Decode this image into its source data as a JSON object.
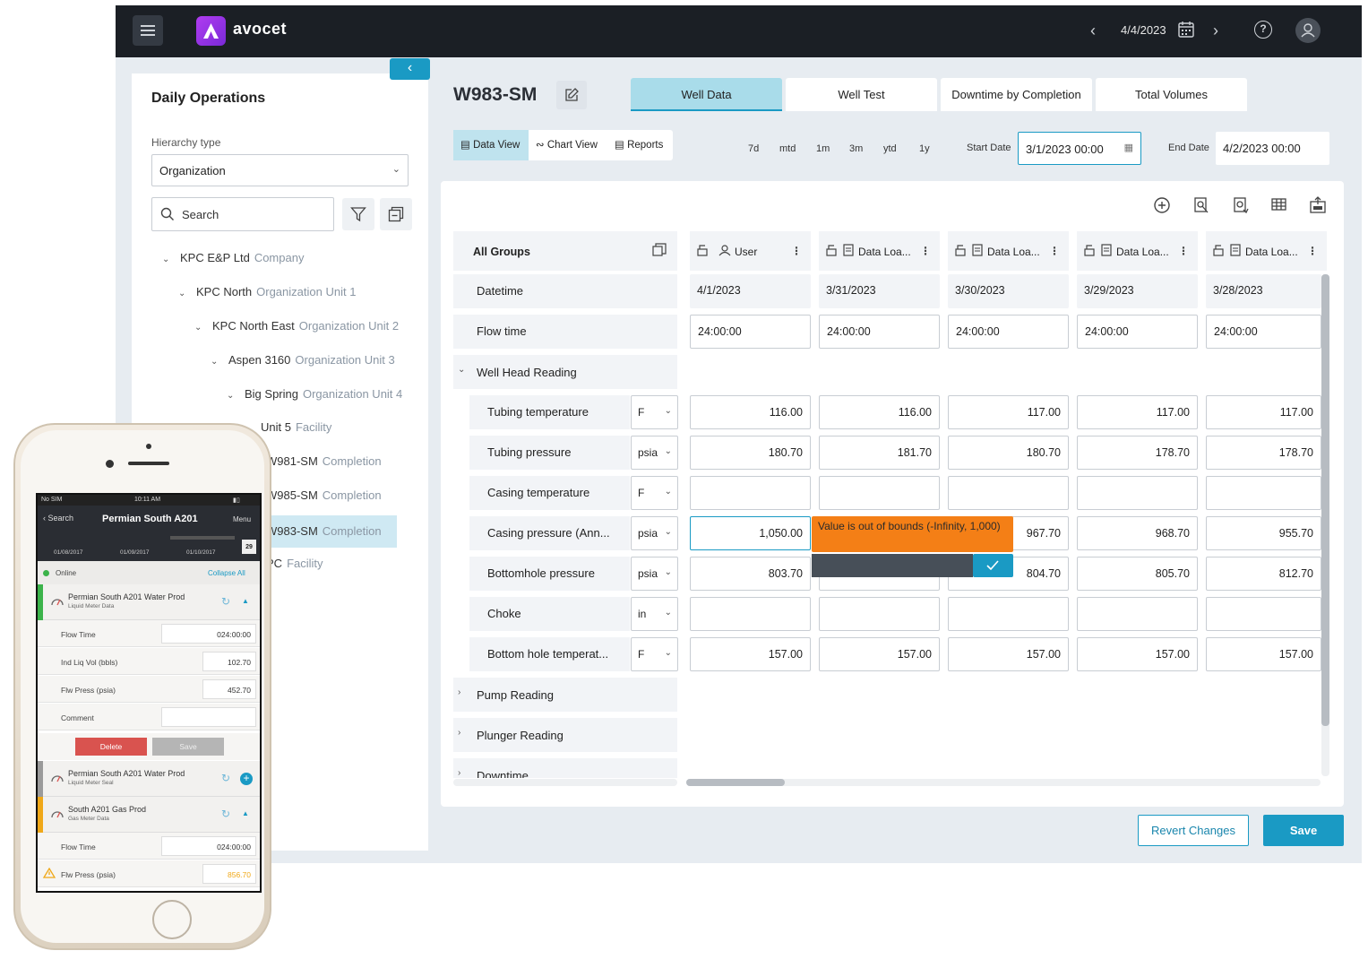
{
  "app": {
    "brand": "avocet",
    "current_date": "4/4/2023"
  },
  "left_panel": {
    "title": "Daily Operations",
    "hierarchy_label": "Hierarchy type",
    "hierarchy_value": "Organization",
    "search_placeholder": "Search",
    "tree": [
      {
        "name": "KPC E&P Ltd",
        "kind": "Company",
        "expanded": true
      },
      {
        "name": "KPC North",
        "kind": "Organization Unit 1",
        "expanded": true
      },
      {
        "name": "KPC North East",
        "kind": "Organization Unit 2",
        "expanded": true
      },
      {
        "name": "Aspen 3160",
        "kind": "Organization Unit 3",
        "expanded": true
      },
      {
        "name": "Big Spring",
        "kind": "Organization Unit 4",
        "expanded": true
      },
      {
        "name": "Unit 5",
        "kind": "Facility",
        "expanded": true
      },
      {
        "name": "W981-SM",
        "kind": "Completion"
      },
      {
        "name": "W985-SM",
        "kind": "Completion"
      },
      {
        "name": "W983-SM",
        "kind": "Completion",
        "selected": true
      },
      {
        "name": "PC",
        "kind": "Facility"
      }
    ]
  },
  "main": {
    "well_title": "W983-SM",
    "tabs": [
      "Well Data",
      "Well Test",
      "Downtime by Completion",
      "Total Volumes"
    ],
    "active_tab": "Well Data",
    "views": [
      "Data View",
      "Chart View",
      "Reports"
    ],
    "active_view": "Data View",
    "ranges": [
      "7d",
      "mtd",
      "1m",
      "3m",
      "ytd",
      "1y"
    ],
    "start_date_label": "Start Date",
    "start_date": "3/1/2023 00:00",
    "end_date_label": "End Date",
    "end_date": "4/2/2023 00:00"
  },
  "grid": {
    "groups_header": "All Groups",
    "columns": [
      {
        "label": "User",
        "date": "4/1/2023",
        "flow_time": "24:00:00"
      },
      {
        "label": "Data Loa...",
        "date": "3/31/2023",
        "flow_time": "24:00:00"
      },
      {
        "label": "Data Loa...",
        "date": "3/30/2023",
        "flow_time": "24:00:00"
      },
      {
        "label": "Data Loa...",
        "date": "3/29/2023",
        "flow_time": "24:00:00"
      },
      {
        "label": "Data Loa...",
        "date": "3/28/2023",
        "flow_time": "24:00:00"
      }
    ],
    "datetime_label": "Datetime",
    "flow_time_label": "Flow time",
    "well_head_group": "Well Head Reading",
    "rows": [
      {
        "label": "Tubing temperature",
        "unit": "F",
        "values": [
          "116.00",
          "116.00",
          "117.00",
          "117.00",
          "117.00"
        ]
      },
      {
        "label": "Tubing pressure",
        "unit": "psia",
        "values": [
          "180.70",
          "181.70",
          "180.70",
          "178.70",
          "178.70"
        ]
      },
      {
        "label": "Casing temperature",
        "unit": "F",
        "values": [
          "",
          "",
          "",
          "",
          ""
        ]
      },
      {
        "label": "Casing pressure (Ann...",
        "unit": "psia",
        "values": [
          "1,050.00",
          "",
          "967.70",
          "968.70",
          "955.70"
        ]
      },
      {
        "label": "Bottomhole pressure",
        "unit": "psia",
        "values": [
          "803.70",
          "",
          "804.70",
          "805.70",
          "812.70"
        ]
      },
      {
        "label": "Choke",
        "unit": "in",
        "values": [
          "",
          "",
          "",
          "",
          ""
        ]
      },
      {
        "label": "Bottom hole temperat...",
        "unit": "F",
        "values": [
          "157.00",
          "157.00",
          "157.00",
          "157.00",
          "157.00"
        ]
      }
    ],
    "other_groups": [
      "Pump Reading",
      "Plunger Reading",
      "Downtime"
    ],
    "error_tooltip": "Value is out of bounds (-Infinity, 1,000)"
  },
  "footer": {
    "revert": "Revert Changes",
    "save": "Save"
  },
  "phone": {
    "status_left": "No SIM",
    "status_time": "10:11 AM",
    "back": "Search",
    "title": "Permian South A201",
    "menu": "Menu",
    "dates": [
      "01/08/2017",
      "01/09/2017",
      "01/10/2017"
    ],
    "cal_day": "29",
    "online": "Online",
    "collapse": "Collapse All",
    "items": [
      {
        "name": "Permian South A201 Water Prod",
        "sub": "Liquid Meter Data"
      },
      {
        "name": "Permian South A201 Water Prod",
        "sub": "Liquid Meter Seal"
      },
      {
        "name": "South A201 Gas Prod",
        "sub": "Gas Meter Data"
      }
    ],
    "fields": [
      {
        "label": "Flow Time",
        "value": "024:00:00"
      },
      {
        "label": "Ind Liq Vol (bbls)",
        "value": "102.70"
      },
      {
        "label": "Flw Press (psia)",
        "value": "452.70"
      },
      {
        "label": "Comment",
        "value": ""
      }
    ],
    "delete": "Delete",
    "save": "Save",
    "fields2": [
      {
        "label": "Flow Time",
        "value": "024:00:00"
      },
      {
        "label": "Flw Press (psia)",
        "value": "856.70"
      }
    ],
    "colors": {
      "accent": "#1a9ac4",
      "green": "#3bb34a",
      "warning": "#f0a818",
      "danger": "#d9534f"
    }
  }
}
